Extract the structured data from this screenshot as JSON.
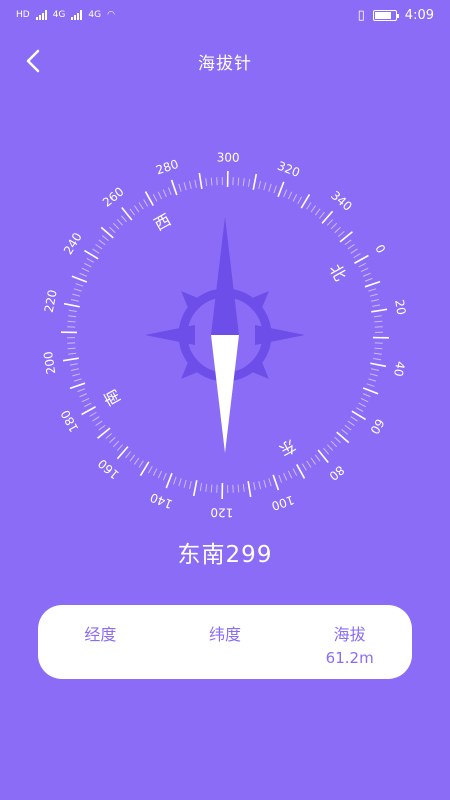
{
  "statusbar": {
    "left_badges": [
      "HD",
      "4G",
      "4G"
    ],
    "time": "4:09"
  },
  "header": {
    "title": "海拔针"
  },
  "compass": {
    "heading_deg": 299,
    "degree_labels": [
      "0",
      "20",
      "40",
      "60",
      "80",
      "100",
      "120",
      "140",
      "160",
      "180",
      "200",
      "220",
      "240",
      "260",
      "280",
      "300",
      "320",
      "340"
    ],
    "cardinals": {
      "north": "北",
      "east": "东",
      "south": "南",
      "west": "西"
    }
  },
  "reading": {
    "direction_text": "东南299"
  },
  "info": {
    "longitude_label": "经度",
    "longitude_value": "",
    "latitude_label": "纬度",
    "latitude_value": "",
    "altitude_label": "海拔",
    "altitude_value": "61.2m"
  },
  "colors": {
    "background": "#8B6CF6",
    "card": "#FFFFFF",
    "needle_dark": "#6D4EE8",
    "text_accent": "#8B6CF6"
  }
}
